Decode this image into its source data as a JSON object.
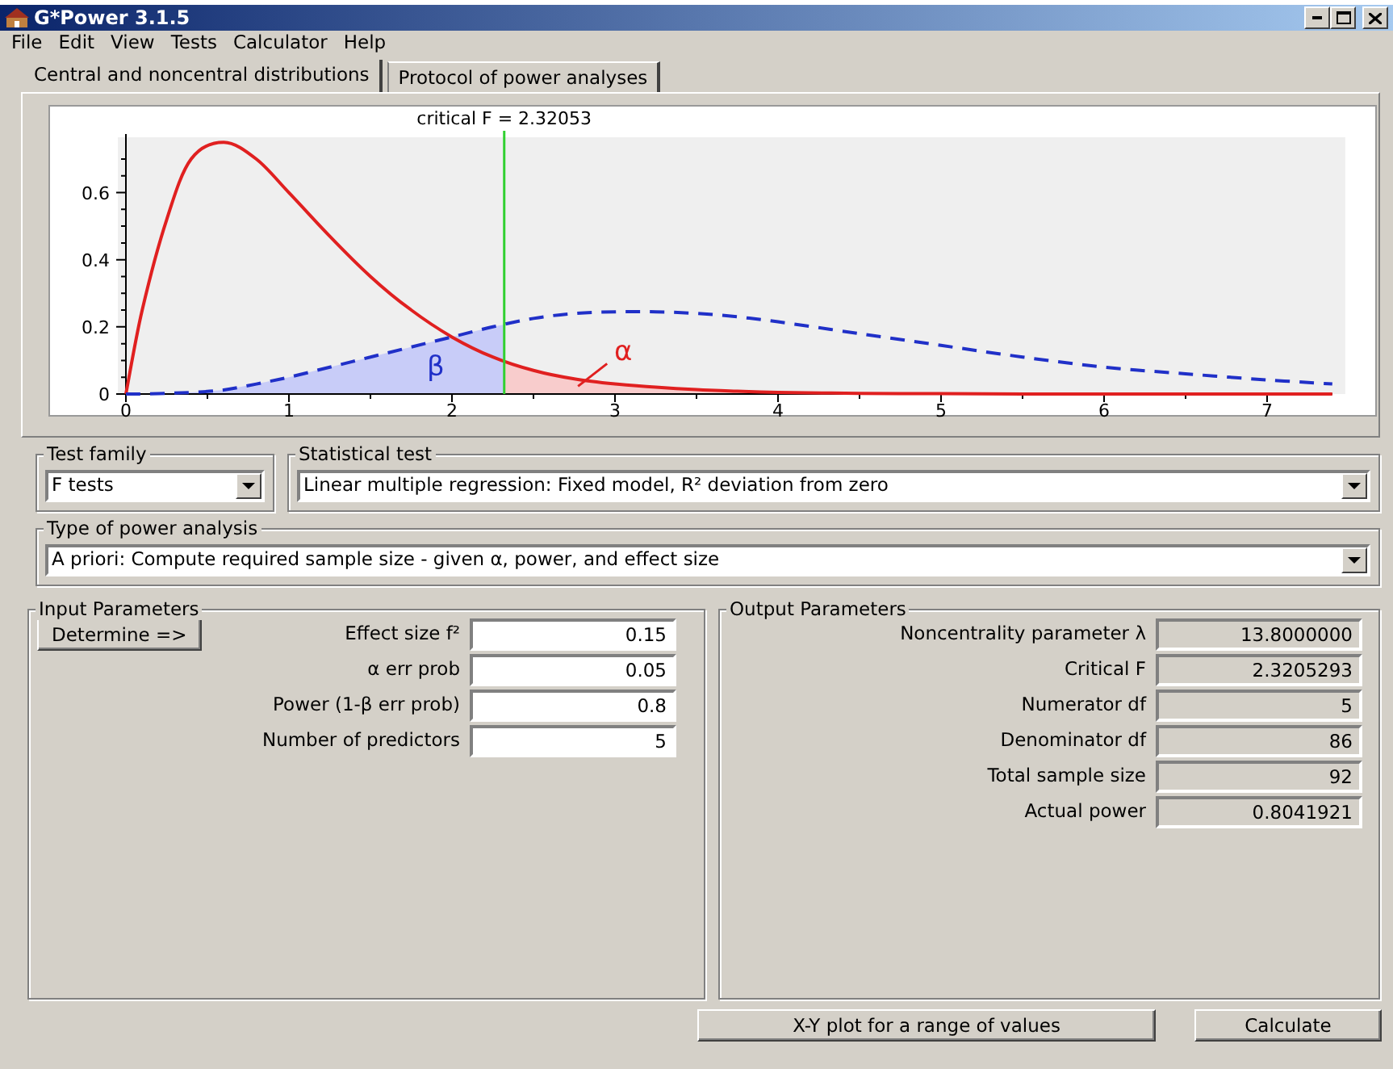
{
  "window": {
    "title": "G*Power 3.1.5"
  },
  "menu": [
    "File",
    "Edit",
    "View",
    "Tests",
    "Calculator",
    "Help"
  ],
  "tabs": [
    {
      "label": "Central and noncentral distributions",
      "selected": true
    },
    {
      "label": "Protocol of power analyses",
      "selected": false
    }
  ],
  "plot": {
    "chart_data": {
      "type": "line",
      "x": [
        0,
        0.1,
        0.25,
        0.4,
        0.6,
        0.8,
        1,
        1.25,
        1.5,
        1.75,
        2,
        2.25,
        2.5,
        2.75,
        3,
        3.25,
        3.5,
        3.75,
        4,
        4.5,
        5,
        5.5,
        6,
        6.5,
        7,
        7.4
      ],
      "series": [
        {
          "color": "#e02020",
          "values": [
            0,
            0.25,
            0.52,
            0.7,
            0.75,
            0.7,
            0.6,
            0.47,
            0.35,
            0.25,
            0.17,
            0.11,
            0.07,
            0.045,
            0.03,
            0.02,
            0.013,
            0.008,
            0.005,
            0.002,
            0.001,
            0,
            0,
            0,
            0,
            0
          ]
        },
        {
          "color": "#2030c8",
          "line_style": "dashed",
          "values": [
            0,
            0,
            0.002,
            0.005,
            0.012,
            0.03,
            0.05,
            0.08,
            0.11,
            0.14,
            0.17,
            0.2,
            0.225,
            0.24,
            0.245,
            0.245,
            0.24,
            0.23,
            0.215,
            0.18,
            0.145,
            0.11,
            0.08,
            0.06,
            0.042,
            0.03
          ]
        }
      ],
      "xlim": [
        0,
        7.4
      ],
      "ylim": [
        0,
        0.76
      ],
      "xticks": [
        0,
        1,
        2,
        3,
        4,
        5,
        6,
        7
      ],
      "yticks": [
        0,
        0.2,
        0.4,
        0.6
      ],
      "ref_lines": [
        {
          "axis": "x",
          "value": 2.32053,
          "label": "critical F = 2.32053"
        }
      ],
      "annotations": [
        "β",
        "α"
      ]
    }
  },
  "test_family": {
    "label": "Test family",
    "value": "F tests"
  },
  "statistical_test": {
    "label": "Statistical test",
    "value": "Linear multiple regression: Fixed model, R² deviation from zero"
  },
  "power_analysis": {
    "label": "Type of power analysis",
    "value": "A priori: Compute required sample size - given α, power, and effect size"
  },
  "input_parameters": {
    "title": "Input Parameters",
    "determine_button": "Determine =>",
    "fields": [
      {
        "label": "Effect size f²",
        "value": "0.15"
      },
      {
        "label": "α err prob",
        "value": "0.05"
      },
      {
        "label": "Power (1-β err prob)",
        "value": "0.8"
      },
      {
        "label": "Number of predictors",
        "value": "5"
      }
    ]
  },
  "output_parameters": {
    "title": "Output Parameters",
    "fields": [
      {
        "label": "Noncentrality parameter λ",
        "value": "13.8000000"
      },
      {
        "label": "Critical F",
        "value": "2.3205293"
      },
      {
        "label": "Numerator df",
        "value": "5"
      },
      {
        "label": "Denominator df",
        "value": "86"
      },
      {
        "label": "Total sample size",
        "value": "92"
      },
      {
        "label": "Actual power",
        "value": "0.8041921"
      }
    ]
  },
  "buttons": [
    {
      "label": "X-Y plot for a range of values"
    },
    {
      "label": "Calculate"
    }
  ]
}
